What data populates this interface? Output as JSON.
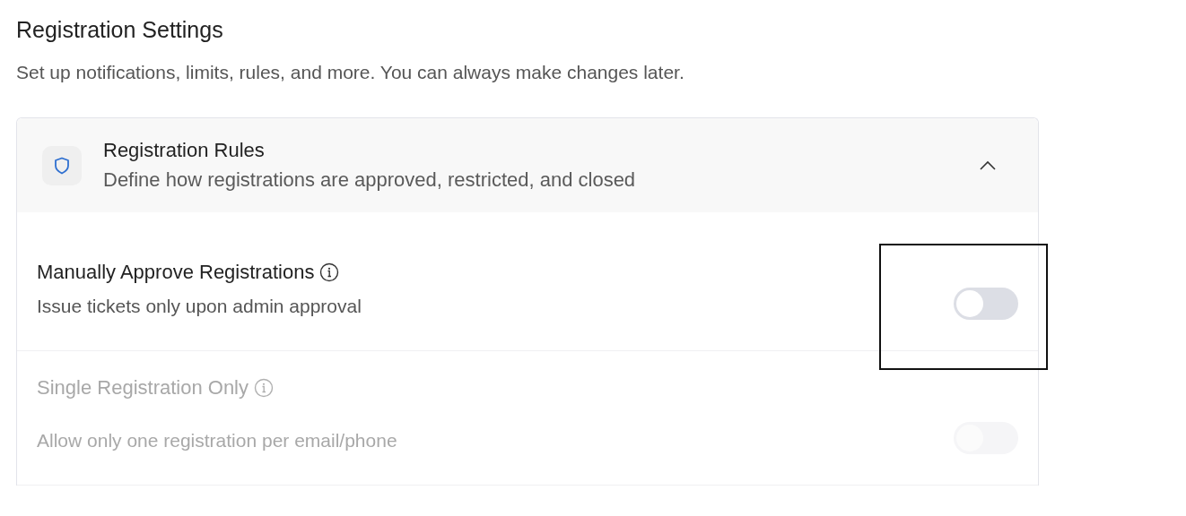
{
  "page": {
    "title": "Registration Settings",
    "subtitle": "Set up notifications, limits, rules, and more. You can always make changes later."
  },
  "section": {
    "title": "Registration Rules",
    "description": "Define how registrations are approved, restricted, and closed",
    "expanded": true
  },
  "settings": [
    {
      "title": "Manually Approve Registrations",
      "description": "Issue tickets only upon admin approval",
      "on": false,
      "disabled": false,
      "highlighted": true
    },
    {
      "title": "Single Registration Only",
      "description": "Allow only one registration per email/phone",
      "on": false,
      "disabled": true,
      "highlighted": false
    }
  ]
}
